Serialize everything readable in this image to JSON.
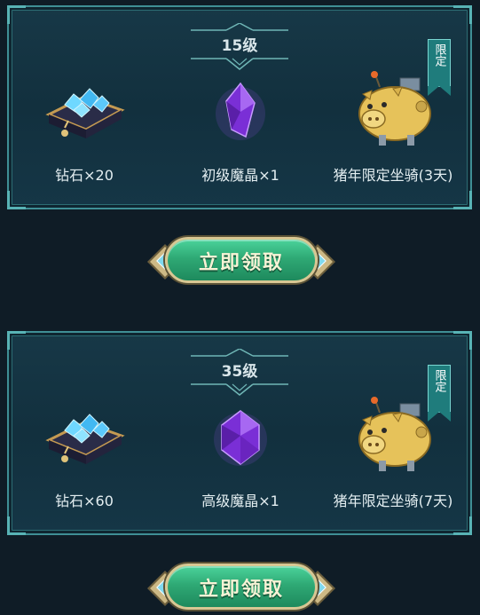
{
  "tiers": [
    {
      "level": "15级",
      "rewards": [
        {
          "label": "钻石×20",
          "icon": "diamond-pile-icon"
        },
        {
          "label": "初级魔晶×1",
          "icon": "purple-crystal-icon"
        },
        {
          "label": "猪年限定坐骑(3天)",
          "icon": "pig-mount-icon",
          "tag": "限定"
        }
      ],
      "button": "立即领取"
    },
    {
      "level": "35级",
      "rewards": [
        {
          "label": "钻石×60",
          "icon": "diamond-pile-icon"
        },
        {
          "label": "高级魔晶×1",
          "icon": "purple-crystal-icon"
        },
        {
          "label": "猪年限定坐骑(7天)",
          "icon": "pig-mount-icon",
          "tag": "限定"
        }
      ],
      "button": "立即领取"
    }
  ],
  "colors": {
    "background": "#0f1c26",
    "panel": "#153646",
    "panel_border": "#3f8f95",
    "button_green": "#2fa975",
    "button_trim": "#d8c793",
    "crystal_purple": "#8a3ae0"
  }
}
